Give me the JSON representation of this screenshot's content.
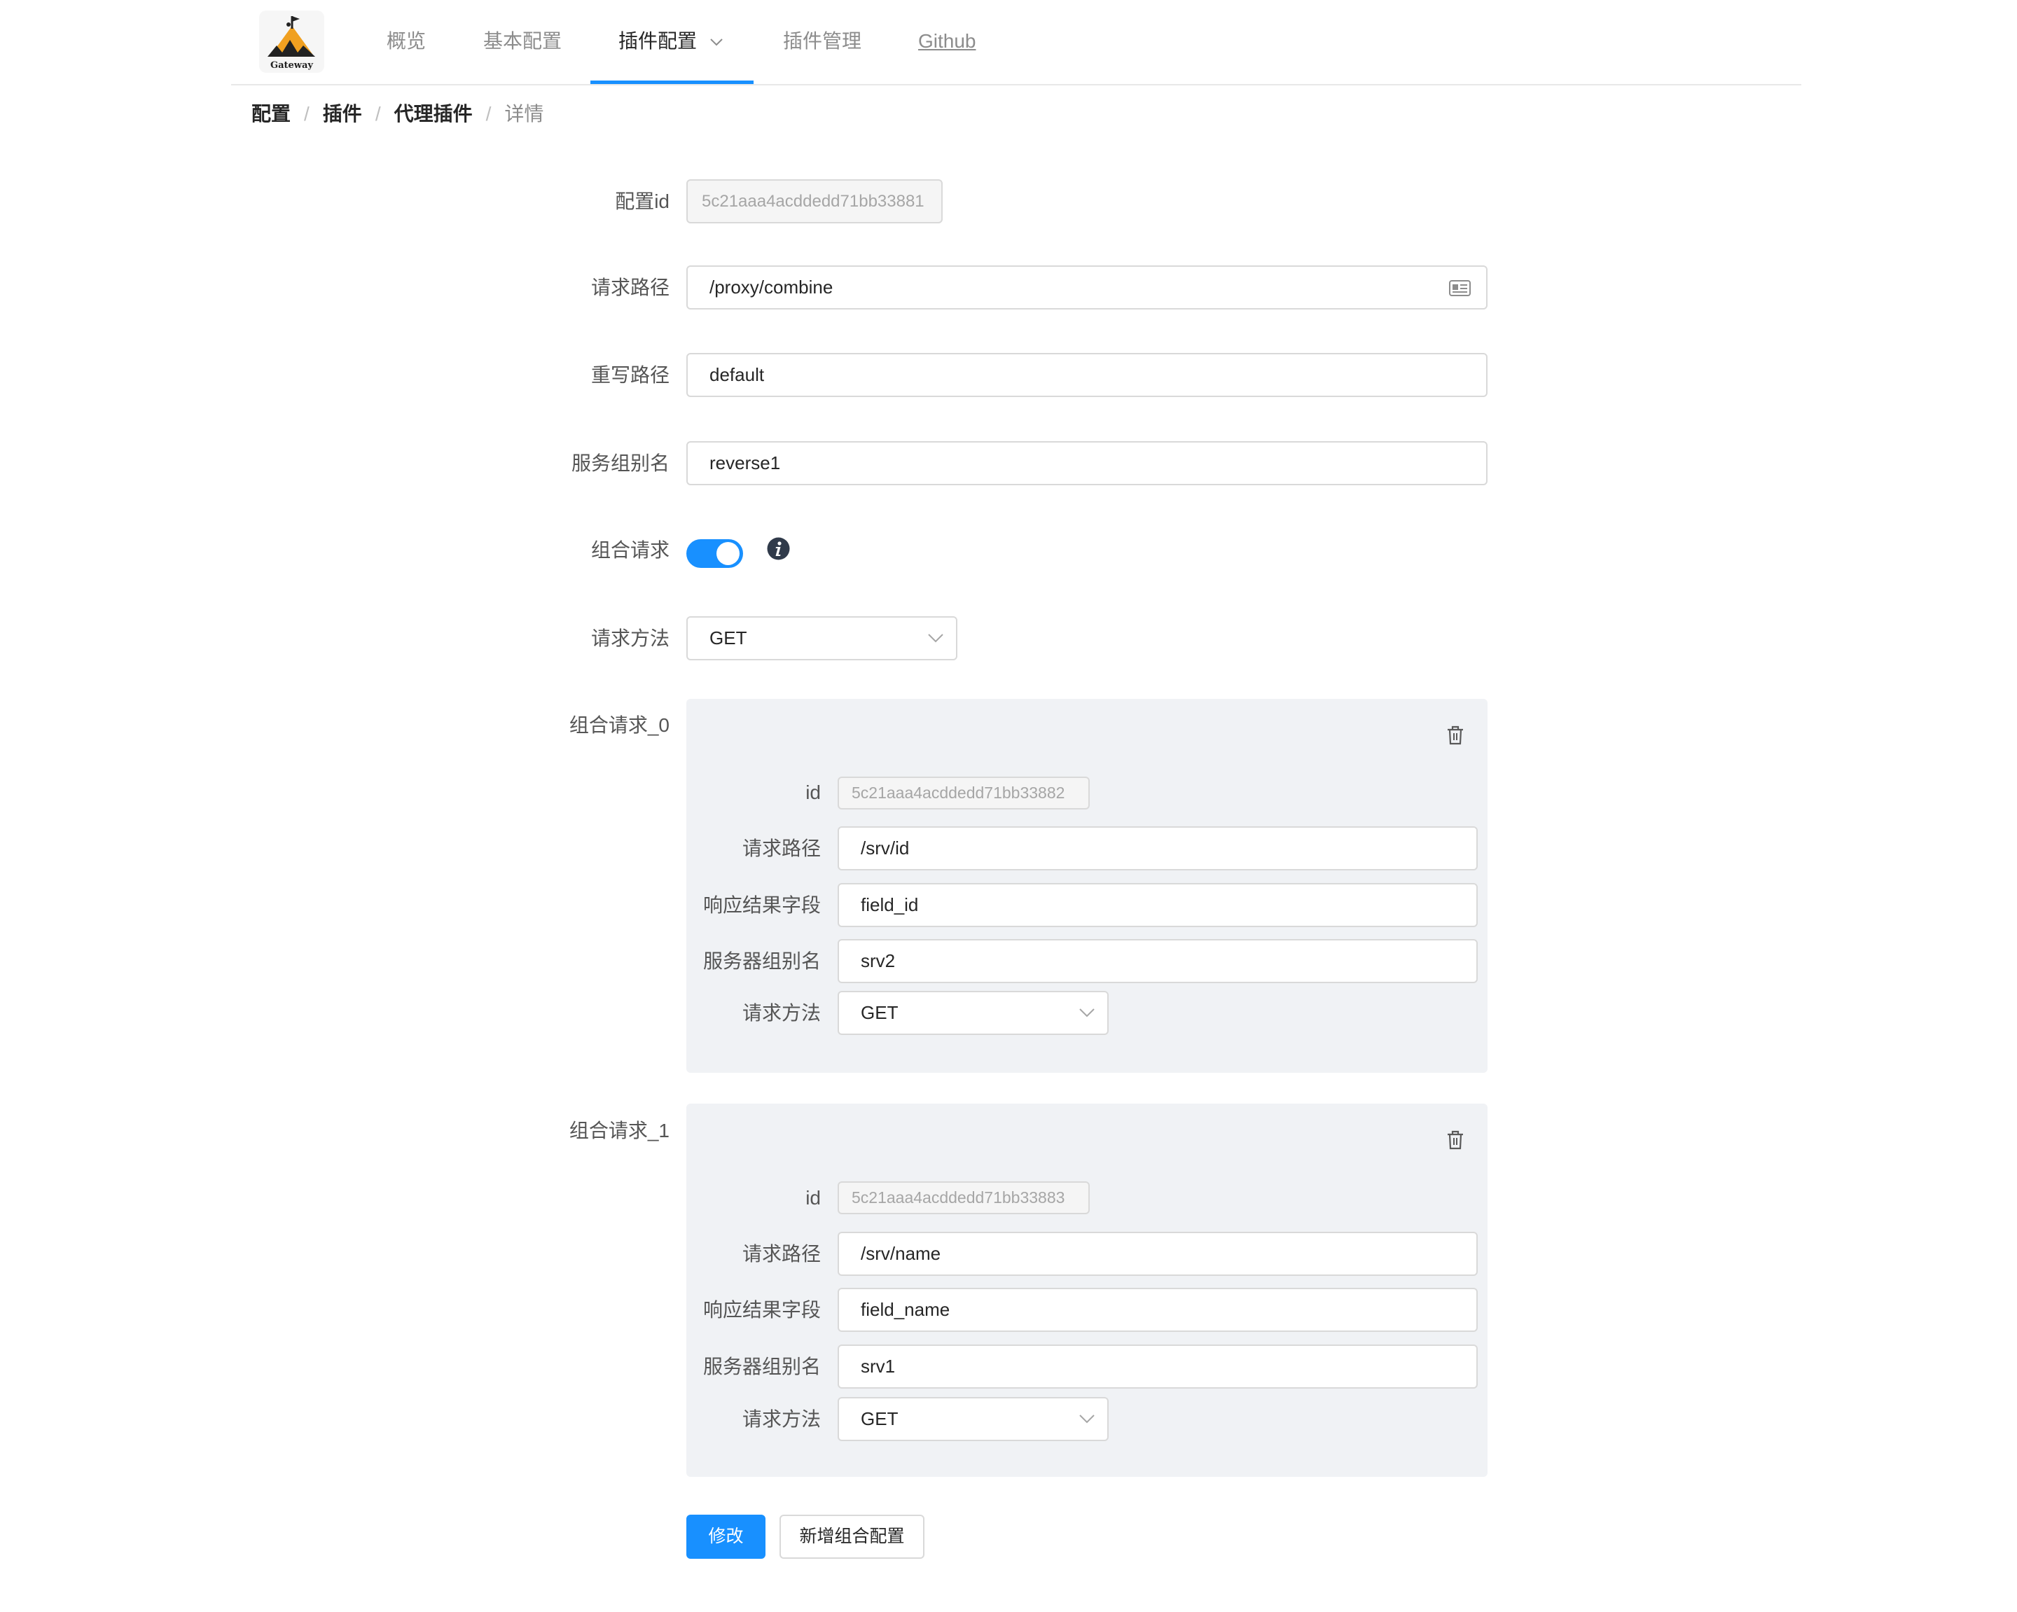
{
  "header": {
    "logo_text": "Gateway",
    "nav": [
      {
        "label": "概览"
      },
      {
        "label": "基本配置"
      },
      {
        "label": "插件配置",
        "active": true,
        "has_dropdown": true
      },
      {
        "label": "插件管理"
      },
      {
        "label": "Github"
      }
    ]
  },
  "breadcrumb": [
    {
      "label": "配置"
    },
    {
      "label": "插件"
    },
    {
      "label": "代理插件"
    },
    {
      "label": "详情"
    }
  ],
  "breadcrumb_separator": "/",
  "form": {
    "config_id": {
      "label": "配置id",
      "value": "5c21aaa4acddedd71bb33881"
    },
    "request_path": {
      "label": "请求路径",
      "value": "/proxy/combine"
    },
    "rewrite_path": {
      "label": "重写路径",
      "value": "default"
    },
    "service_group": {
      "label": "服务组别名",
      "value": "reverse1"
    },
    "combine": {
      "label": "组合请求",
      "enabled": true
    },
    "method": {
      "label": "请求方法",
      "value": "GET"
    },
    "combos": [
      {
        "label": "组合请求_0",
        "id_label": "id",
        "id": "5c21aaa4acddedd71bb33882",
        "path_label": "请求路径",
        "path": "/srv/id",
        "field_label": "响应结果字段",
        "field": "field_id",
        "group_label": "服务器组别名",
        "group": "srv2",
        "method_label": "请求方法",
        "method": "GET"
      },
      {
        "label": "组合请求_1",
        "id_label": "id",
        "id": "5c21aaa4acddedd71bb33883",
        "path_label": "请求路径",
        "path": "/srv/name",
        "field_label": "响应结果字段",
        "field": "field_name",
        "group_label": "服务器组别名",
        "group": "srv1",
        "method_label": "请求方法",
        "method": "GET"
      }
    ]
  },
  "actions": {
    "submit": "修改",
    "add": "新增组合配置"
  },
  "colors": {
    "accent": "#1890ff",
    "panel_background": "#f0f2f5",
    "border": "#d9d9d9",
    "text": "#262626",
    "muted": "#8c8c8c",
    "info_icon": "#303a4a"
  },
  "icons": {
    "path_field": "id-card-icon",
    "combine_help": "info-icon",
    "delete_combo": "trash-icon",
    "select": "chevron-down-icon",
    "nav_dropdown": "chevron-down-icon"
  }
}
